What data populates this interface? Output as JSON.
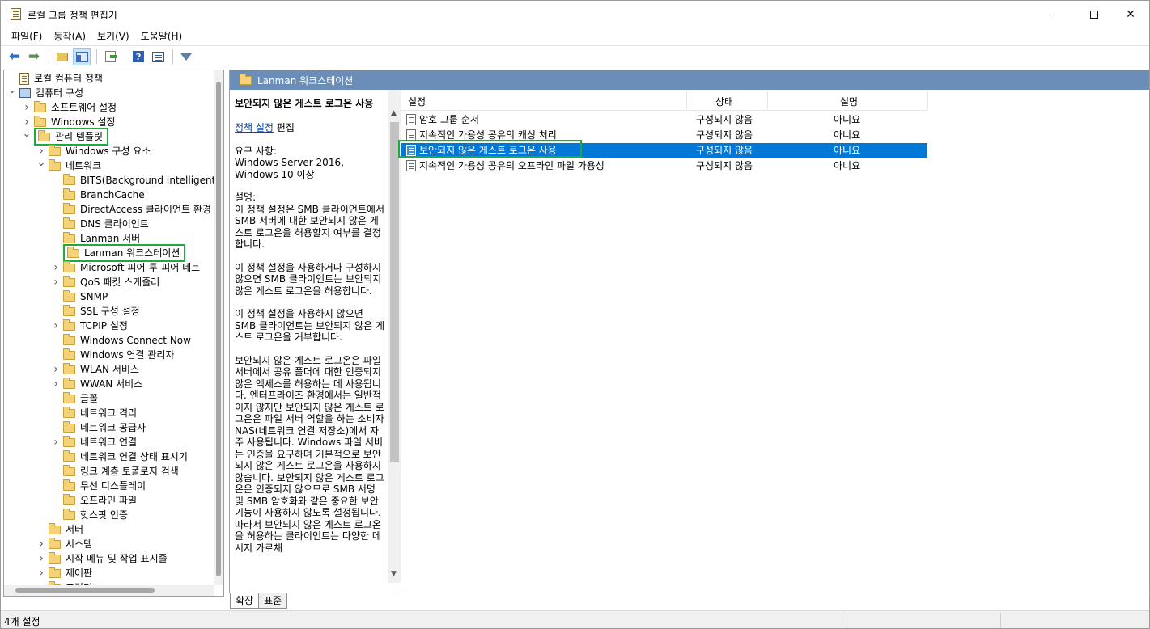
{
  "window": {
    "title": "로컬 그룹 정책 편집기"
  },
  "menu": [
    "파일(F)",
    "동작(A)",
    "보기(V)",
    "도움말(H)"
  ],
  "toolbar": {
    "icons": [
      "back-arrow-icon",
      "forward-arrow-icon",
      "folder-up-icon",
      "show-hide-tree-icon",
      "export-list-icon",
      "help-icon",
      "properties-icon",
      "filter-icon"
    ]
  },
  "tree": {
    "items": [
      {
        "label": "로컬 컴퓨터 정책",
        "level": 0,
        "expander": "",
        "icon": "policy"
      },
      {
        "label": "컴퓨터 구성",
        "level": 0,
        "expander": "open",
        "icon": "computer"
      },
      {
        "label": "소프트웨어 설정",
        "level": 1,
        "expander": "closed",
        "icon": "folder"
      },
      {
        "label": "Windows 설정",
        "level": 1,
        "expander": "closed",
        "icon": "folder"
      },
      {
        "label": "관리 템플릿",
        "level": 1,
        "expander": "open",
        "icon": "folder",
        "highlight": true
      },
      {
        "label": "Windows 구성 요소",
        "level": 2,
        "expander": "closed",
        "icon": "folder"
      },
      {
        "label": "네트워크",
        "level": 2,
        "expander": "open",
        "icon": "folder"
      },
      {
        "label": "BITS(Background Intelligent T",
        "level": 3,
        "expander": "",
        "icon": "folder"
      },
      {
        "label": "BranchCache",
        "level": 3,
        "expander": "",
        "icon": "folder"
      },
      {
        "label": "DirectAccess 클라이언트 환경",
        "level": 3,
        "expander": "",
        "icon": "folder"
      },
      {
        "label": "DNS 클라이언트",
        "level": 3,
        "expander": "",
        "icon": "folder"
      },
      {
        "label": "Lanman 서버",
        "level": 3,
        "expander": "",
        "icon": "folder"
      },
      {
        "label": "Lanman 워크스테이션",
        "level": 3,
        "expander": "",
        "icon": "folder",
        "highlight": true
      },
      {
        "label": "Microsoft 피어-투-피어 네트",
        "level": 3,
        "expander": "closed",
        "icon": "folder"
      },
      {
        "label": "QoS 패킷 스케줄러",
        "level": 3,
        "expander": "closed",
        "icon": "folder"
      },
      {
        "label": "SNMP",
        "level": 3,
        "expander": "",
        "icon": "folder"
      },
      {
        "label": "SSL 구성 설정",
        "level": 3,
        "expander": "",
        "icon": "folder"
      },
      {
        "label": "TCPIP 설정",
        "level": 3,
        "expander": "closed",
        "icon": "folder"
      },
      {
        "label": "Windows Connect Now",
        "level": 3,
        "expander": "",
        "icon": "folder"
      },
      {
        "label": "Windows 연결 관리자",
        "level": 3,
        "expander": "",
        "icon": "folder"
      },
      {
        "label": "WLAN 서비스",
        "level": 3,
        "expander": "closed",
        "icon": "folder"
      },
      {
        "label": "WWAN 서비스",
        "level": 3,
        "expander": "closed",
        "icon": "folder"
      },
      {
        "label": "글꼴",
        "level": 3,
        "expander": "",
        "icon": "folder"
      },
      {
        "label": "네트워크 격리",
        "level": 3,
        "expander": "",
        "icon": "folder"
      },
      {
        "label": "네트워크 공급자",
        "level": 3,
        "expander": "",
        "icon": "folder"
      },
      {
        "label": "네트워크 연결",
        "level": 3,
        "expander": "closed",
        "icon": "folder"
      },
      {
        "label": "네트워크 연결 상태 표시기",
        "level": 3,
        "expander": "",
        "icon": "folder"
      },
      {
        "label": "링크 계층 토폴로지 검색",
        "level": 3,
        "expander": "",
        "icon": "folder"
      },
      {
        "label": "무선 디스플레이",
        "level": 3,
        "expander": "",
        "icon": "folder"
      },
      {
        "label": "오프라인 파일",
        "level": 3,
        "expander": "",
        "icon": "folder"
      },
      {
        "label": "핫스팟 인증",
        "level": 3,
        "expander": "",
        "icon": "folder"
      },
      {
        "label": "서버",
        "level": 2,
        "expander": "",
        "icon": "folder"
      },
      {
        "label": "시스템",
        "level": 2,
        "expander": "closed",
        "icon": "folder"
      },
      {
        "label": "시작 메뉴 및 작업 표시줄",
        "level": 2,
        "expander": "closed",
        "icon": "folder"
      },
      {
        "label": "제어판",
        "level": 2,
        "expander": "closed",
        "icon": "folder"
      },
      {
        "label": "프린터",
        "level": 2,
        "expander": "",
        "icon": "folder"
      }
    ]
  },
  "right": {
    "header": "Lanman 워크스테이션",
    "description": {
      "title": "보안되지 않은 게스트 로그온 사용",
      "edit_link": "정책 설정",
      "edit_suffix": " 편집",
      "requirements": "요구 사항:\nWindows Server 2016, Windows 10 이상",
      "paragraphs": [
        "설명:\n이 정책 설정은 SMB 클라이언트에서 SMB 서버에 대한 보안되지 않은 게스트 로그온을 허용할지 여부를 결정합니다.",
        "이 정책 설정을 사용하거나 구성하지 않으면 SMB 클라이언트는 보안되지 않은 게스트 로그온을 허용합니다.",
        "이 정책 설정을 사용하지 않으면 SMB 클라이언트는 보안되지 않은 게스트 로그온을 거부합니다.",
        "보안되지 않은 게스트 로그온은 파일 서버에서 공유 폴더에 대한 인증되지 않은 액세스를 허용하는 데 사용됩니다. 엔터프라이즈 환경에서는 일반적이지 않지만 보안되지 않은 게스트 로그온은 파일 서버 역할을 하는 소비자 NAS(네트워크 연결 저장소)에서 자주 사용됩니다. Windows 파일 서버는 인증을 요구하며 기본적으로 보안되지 않은 게스트 로그온을 사용하지 않습니다. 보안되지 않은 게스트 로그온은 인증되지 않으므로 SMB 서명 및 SMB 암호화와 같은 중요한 보안 기능이 사용하지 않도록 설정됩니다. 따라서 보안되지 않은 게스트 로그온을 허용하는 클라이언트는 다양한 메시지 가로채"
      ]
    },
    "columns": [
      "설정",
      "상태",
      "설명"
    ],
    "rows": [
      {
        "setting": "암호 그룹 순서",
        "state": "구성되지 않음",
        "comment": "아니요",
        "selected": false
      },
      {
        "setting": "지속적인 가용성 공유의 캐싱 처리",
        "state": "구성되지 않음",
        "comment": "아니요",
        "selected": false
      },
      {
        "setting": "보안되지 않은 게스트 로그온 사용",
        "state": "구성되지 않음",
        "comment": "아니요",
        "selected": true
      },
      {
        "setting": "지속적인 가용성 공유의 오프라인 파일 가용성",
        "state": "구성되지 않음",
        "comment": "아니요",
        "selected": false
      }
    ]
  },
  "tabs": [
    "확장",
    "표준"
  ],
  "status": "4개 설정"
}
